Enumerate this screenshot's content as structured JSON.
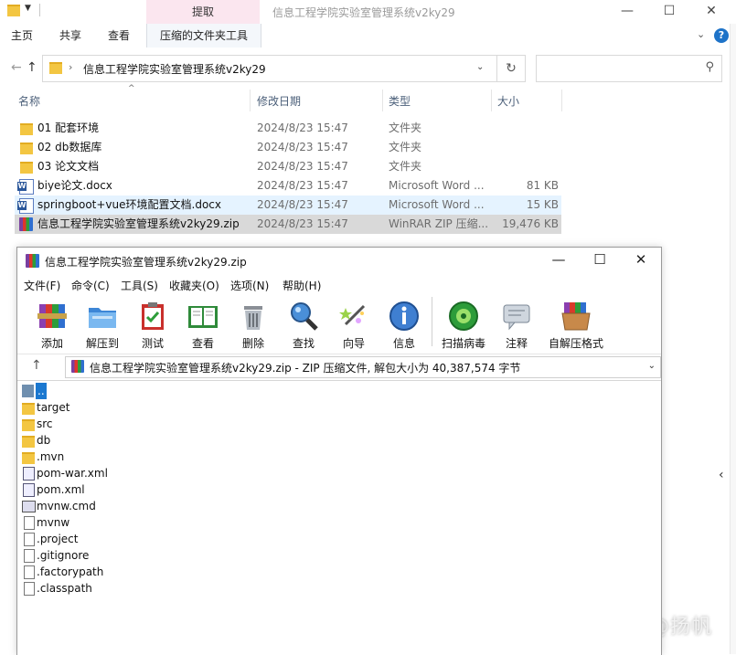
{
  "explorer": {
    "title": "信息工程学院实验室管理系统v2ky29",
    "context_tab_group": "提取",
    "ribbon_tabs": [
      "主页",
      "共享",
      "查看",
      "压缩的文件夹工具"
    ],
    "address_path": "信息工程学院实验室管理系统v2ky29",
    "search_placeholder": "",
    "columns": {
      "name": "名称",
      "date": "修改日期",
      "type": "类型",
      "size": "大小"
    },
    "files": [
      {
        "name": "01 配套环境",
        "date": "2024/8/23 15:47",
        "type": "文件夹",
        "size": "",
        "icon": "folder-icon"
      },
      {
        "name": "02 db数据库",
        "date": "2024/8/23 15:47",
        "type": "文件夹",
        "size": "",
        "icon": "folder-icon"
      },
      {
        "name": "03 论文文档",
        "date": "2024/8/23 15:47",
        "type": "文件夹",
        "size": "",
        "icon": "folder-icon"
      },
      {
        "name": "biye论文.docx",
        "date": "2024/8/23 15:47",
        "type": "Microsoft Word ...",
        "size": "81 KB",
        "icon": "word-doc-icon"
      },
      {
        "name": "springboot+vue环境配置文档.docx",
        "date": "2024/8/23 15:47",
        "type": "Microsoft Word ...",
        "size": "15 KB",
        "icon": "word-doc-icon"
      },
      {
        "name": "信息工程学院实验室管理系统v2ky29.zip",
        "date": "2024/8/23 15:47",
        "type": "WinRAR ZIP 压缩...",
        "size": "19,476 KB",
        "icon": "winrar-zip-icon"
      }
    ],
    "watermark": "知乎 @扬帆"
  },
  "winrar": {
    "title": "信息工程学院实验室管理系统v2ky29.zip",
    "menu": [
      "文件(F)",
      "命令(C)",
      "工具(S)",
      "收藏夹(O)",
      "选项(N)",
      "帮助(H)"
    ],
    "toolbar": [
      {
        "label": "添加",
        "icon": "add-archive-icon"
      },
      {
        "label": "解压到",
        "icon": "extract-folder-icon"
      },
      {
        "label": "测试",
        "icon": "test-clipboard-icon"
      },
      {
        "label": "查看",
        "icon": "view-book-icon"
      },
      {
        "label": "删除",
        "icon": "delete-trash-icon"
      },
      {
        "label": "查找",
        "icon": "find-magnifier-icon"
      },
      {
        "label": "向导",
        "icon": "wizard-wand-icon"
      },
      {
        "label": "信息",
        "icon": "info-icon"
      },
      {
        "label": "扫描病毒",
        "icon": "virus-scan-icon"
      },
      {
        "label": "注释",
        "icon": "comment-icon"
      },
      {
        "label": "自解压格式",
        "icon": "sfx-box-icon"
      }
    ],
    "path_text": "信息工程学院实验室管理系统v2ky29.zip - ZIP 压缩文件, 解包大小为 40,387,574 字节",
    "entries": [
      {
        "name": "..",
        "kind": "up"
      },
      {
        "name": "target",
        "kind": "folder"
      },
      {
        "name": "src",
        "kind": "folder"
      },
      {
        "name": "db",
        "kind": "folder"
      },
      {
        "name": ".mvn",
        "kind": "folder"
      },
      {
        "name": "pom-war.xml",
        "kind": "xml"
      },
      {
        "name": "pom.xml",
        "kind": "xml"
      },
      {
        "name": "mvnw.cmd",
        "kind": "cmd"
      },
      {
        "name": "mvnw",
        "kind": "file"
      },
      {
        "name": ".project",
        "kind": "file"
      },
      {
        "name": ".gitignore",
        "kind": "file"
      },
      {
        "name": ".factorypath",
        "kind": "file"
      },
      {
        "name": ".classpath",
        "kind": "file"
      }
    ]
  }
}
